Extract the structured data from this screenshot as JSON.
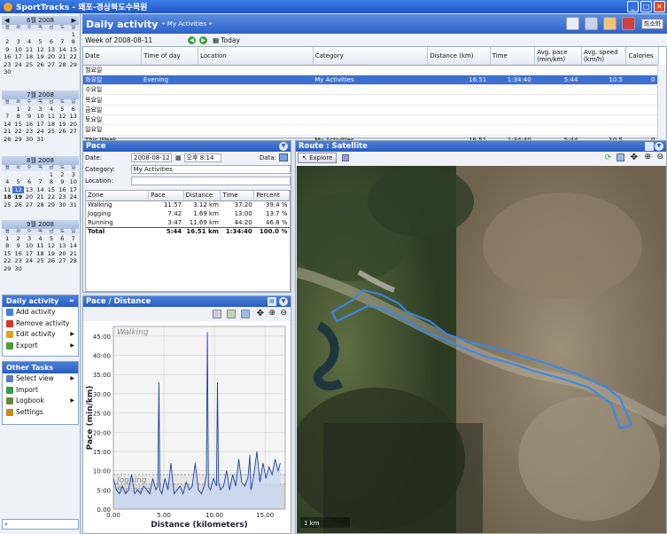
{
  "window": {
    "title": "SportTracks - 왜포-경상북도수목원",
    "buttons": [
      "_",
      "□",
      "✕"
    ]
  },
  "calendar": [
    {
      "title": "6월 2008",
      "weekdays": [
        "월",
        "화",
        "수",
        "목",
        "금",
        "토",
        "일"
      ],
      "days": [
        "",
        "",
        "",
        "",
        "",
        "",
        "1",
        "2",
        "3",
        "4",
        "5",
        "6",
        "7",
        "8",
        "9",
        "10",
        "11",
        "12",
        "13",
        "14",
        "15",
        "16",
        "17",
        "18",
        "19",
        "20",
        "21",
        "22",
        "23",
        "24",
        "25",
        "26",
        "27",
        "28",
        "29",
        "30"
      ]
    },
    {
      "title": "7월 2008",
      "weekdays": [
        "월",
        "화",
        "수",
        "목",
        "금",
        "토",
        "일"
      ],
      "days": [
        "",
        "1",
        "2",
        "3",
        "4",
        "5",
        "6",
        "7",
        "8",
        "9",
        "10",
        "11",
        "12",
        "13",
        "14",
        "15",
        "16",
        "17",
        "18",
        "19",
        "20",
        "21",
        "22",
        "23",
        "24",
        "25",
        "26",
        "27",
        "28",
        "29",
        "30",
        "31"
      ]
    },
    {
      "title": "8월 2008",
      "weekdays": [
        "월",
        "화",
        "수",
        "목",
        "금",
        "토",
        "일"
      ],
      "days": [
        "",
        "",
        "",
        "",
        "1",
        "2",
        "3",
        "4",
        "5",
        "6",
        "7",
        "8",
        "9",
        "10",
        "11",
        "12",
        "13",
        "14",
        "15",
        "16",
        "17",
        "18",
        "19",
        "20",
        "21",
        "22",
        "23",
        "24",
        "25",
        "26",
        "27",
        "28",
        "29",
        "30",
        "31"
      ]
    },
    {
      "title": "9월 2008",
      "weekdays": [
        "월",
        "화",
        "수",
        "목",
        "금",
        "토",
        "일"
      ],
      "days": [
        "1",
        "2",
        "3",
        "4",
        "5",
        "6",
        "7",
        "8",
        "9",
        "10",
        "11",
        "12",
        "13",
        "14",
        "15",
        "16",
        "17",
        "18",
        "19",
        "20",
        "21",
        "22",
        "23",
        "24",
        "25",
        "26",
        "27",
        "28",
        "29",
        "30"
      ]
    }
  ],
  "tasks": {
    "daily_title": "Daily activity",
    "daily_items": [
      {
        "label": "Add activity",
        "icon": "add-icon",
        "color": "#3b7de0",
        "arrow": false
      },
      {
        "label": "Remove activity",
        "icon": "remove-icon",
        "color": "#d8352a",
        "arrow": false
      },
      {
        "label": "Edit activity",
        "icon": "edit-icon",
        "color": "#e0a020",
        "arrow": true
      },
      {
        "label": "Export",
        "icon": "export-icon",
        "color": "#4d9b3a",
        "arrow": true
      }
    ],
    "other_title": "Other Tasks",
    "other_items": [
      {
        "label": "Select view",
        "icon": "view-icon",
        "color": "#5a7fc0",
        "arrow": true
      },
      {
        "label": "Import",
        "icon": "import-icon",
        "color": "#3a9a4a",
        "arrow": false
      },
      {
        "label": "Logbook",
        "icon": "logbook-icon",
        "color": "#6a8a3a",
        "arrow": true
      },
      {
        "label": "Settings",
        "icon": "settings-icon",
        "color": "#c88a20",
        "arrow": false
      }
    ]
  },
  "header": {
    "title": "Daily activity",
    "subtitle": "• My Activities  •",
    "right_button": "최소화"
  },
  "week": {
    "label": "Week of 2008-08-11",
    "today": "Today"
  },
  "activities": {
    "columns": [
      "Date",
      "Time of day",
      "Location",
      "Category",
      "Distance (km)",
      "Time",
      "Avg. pace (min/km)",
      "Avg. speed (km/h)",
      "Calories"
    ],
    "rows": [
      {
        "date": "월요일",
        "time_of_day": "",
        "location": "",
        "category": "",
        "distance": "",
        "time": "",
        "pace": "",
        "speed": "",
        "calories": ""
      },
      {
        "date": "화요일",
        "time_of_day": "Evening",
        "location": "",
        "category": "My Activities",
        "distance": "16.51",
        "time": "1:34:40",
        "pace": "5:44",
        "speed": "10.5",
        "calories": "0",
        "selected": true
      },
      {
        "date": "수요일",
        "time_of_day": "",
        "location": "",
        "category": "",
        "distance": "",
        "time": "",
        "pace": "",
        "speed": "",
        "calories": ""
      },
      {
        "date": "목요일",
        "time_of_day": "",
        "location": "",
        "category": "",
        "distance": "",
        "time": "",
        "pace": "",
        "speed": "",
        "calories": ""
      },
      {
        "date": "금요일",
        "time_of_day": "",
        "location": "",
        "category": "",
        "distance": "",
        "time": "",
        "pace": "",
        "speed": "",
        "calories": ""
      },
      {
        "date": "토요일",
        "time_of_day": "",
        "location": "",
        "category": "",
        "distance": "",
        "time": "",
        "pace": "",
        "speed": "",
        "calories": ""
      },
      {
        "date": "일요일",
        "time_of_day": "",
        "location": "",
        "category": "",
        "distance": "",
        "time": "",
        "pace": "",
        "speed": "",
        "calories": ""
      },
      {
        "date": "This Week",
        "time_of_day": "",
        "location": "",
        "category": "My Activities",
        "distance": "16.51",
        "time": "1:34:40",
        "pace": "5:44",
        "speed": "10.5",
        "calories": "0"
      }
    ]
  },
  "pace": {
    "title": "Pace",
    "date_label": "Date:",
    "date_value": "2008-08-12",
    "time_value": "오후 8:14",
    "data_label": "Data:",
    "category_label": "Category:",
    "category_value": "My Activities",
    "location_label": "Location:",
    "location_value": "",
    "zone_columns": [
      "Zone",
      "Pace",
      "Distance",
      "Time",
      "Percent"
    ],
    "zones": [
      {
        "zone": "Walking",
        "pace": "11:57",
        "distance": "3.12 km",
        "time": "37:20",
        "percent": "39.4 %"
      },
      {
        "zone": "Jogging",
        "pace": "7:42",
        "distance": "1.69 km",
        "time": "13:00",
        "percent": "13.7 %"
      },
      {
        "zone": "Running",
        "pace": "3:47",
        "distance": "11.69 km",
        "time": "44:20",
        "percent": "46.8 %"
      },
      {
        "zone": "Total",
        "pace": "5:44",
        "distance": "16.51 km",
        "time": "1:34:40",
        "percent": "100.0 %",
        "total": true
      }
    ]
  },
  "chart_data": {
    "type": "line",
    "title": "Pace / Distance",
    "xlabel": "Distance (kilometers)",
    "ylabel": "Pace (min/km)",
    "xlim": [
      0,
      17
    ],
    "ylim": [
      0,
      47.5
    ],
    "xticks": [
      "0.00",
      "5.00",
      "10.00",
      "15.00"
    ],
    "xtick_values": [
      0,
      5,
      10,
      15
    ],
    "yticks": [
      "0.00",
      "5:00",
      "10:00",
      "15:00",
      "20:00",
      "25:00",
      "30:00",
      "35:00",
      "40:00",
      "45:00"
    ],
    "ytick_values": [
      0,
      5,
      10,
      15,
      20,
      25,
      30,
      35,
      40,
      45
    ],
    "zones": [
      {
        "name": "Walking",
        "min": 9,
        "max": 47.5
      },
      {
        "name": "Jogging",
        "min": 6.5,
        "max": 9
      },
      {
        "name": "Running",
        "min": 0,
        "max": 6.5
      }
    ],
    "series": [
      {
        "x": [
          0,
          0.3,
          0.6,
          0.9,
          1.2,
          1.5,
          1.8,
          2.1,
          2.4,
          2.7,
          3.0,
          3.3,
          3.6,
          3.9,
          4.2,
          4.4,
          4.5,
          4.6,
          4.8,
          5.1,
          5.4,
          5.7,
          6.0,
          6.3,
          6.6,
          6.9,
          7.2,
          7.5,
          7.8,
          8.1,
          8.4,
          8.7,
          9.0,
          9.2,
          9.3,
          9.4,
          9.6,
          9.9,
          10.2,
          10.3,
          10.4,
          10.6,
          10.9,
          11.2,
          11.5,
          11.8,
          12.1,
          12.4,
          12.7,
          13.0,
          13.3,
          13.5,
          13.6,
          13.7,
          13.9,
          14.2,
          14.5,
          14.8,
          15.1,
          15.4,
          15.7,
          16.0,
          16.3,
          16.51
        ],
        "y": [
          8,
          5,
          4,
          6,
          4,
          5,
          9,
          4,
          5,
          4,
          6,
          5,
          4,
          8,
          5,
          6,
          33,
          5,
          4,
          8,
          5,
          12,
          4,
          5,
          6,
          4,
          7,
          5,
          6,
          12,
          5,
          4,
          6,
          9,
          46,
          6,
          5,
          8,
          6,
          33,
          7,
          5,
          6,
          10,
          5,
          9,
          6,
          13,
          7,
          6,
          8,
          14,
          5,
          6,
          9,
          15,
          7,
          12,
          8,
          11,
          9,
          13,
          10,
          12
        ]
      }
    ]
  },
  "map": {
    "title": "Route : Satellite",
    "explore": "Explore",
    "scale_label": "1 km"
  }
}
